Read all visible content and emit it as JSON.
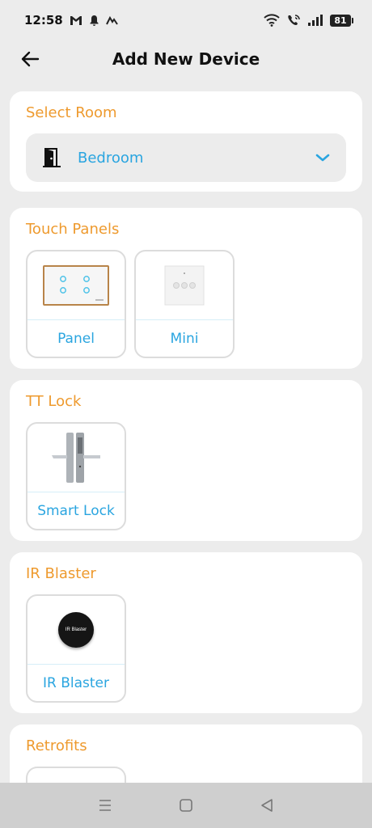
{
  "status_bar": {
    "time": "12:58",
    "battery": "81",
    "left_icons": [
      "gmail-icon",
      "notification-bell-icon",
      "app-icon"
    ],
    "right_icons": [
      "wifi-icon",
      "wifi-calling-icon",
      "signal-icon",
      "battery-icon"
    ]
  },
  "header": {
    "title": "Add New Device",
    "back_icon": "back-arrow-icon"
  },
  "select_room": {
    "title": "Select Room",
    "value": "Bedroom",
    "icon": "door-icon",
    "chevron_icon": "chevron-down-icon"
  },
  "sections": [
    {
      "title": "Touch Panels",
      "items": [
        {
          "label": "Panel",
          "image": "touch-panel-image"
        },
        {
          "label": "Mini",
          "image": "mini-panel-image"
        }
      ]
    },
    {
      "title": "TT Lock",
      "items": [
        {
          "label": "Smart Lock",
          "image": "smart-lock-image"
        }
      ]
    },
    {
      "title": "IR Blaster",
      "items": [
        {
          "label": "IR Blaster",
          "image": "ir-blaster-image",
          "image_text": "IR Blaster"
        }
      ]
    },
    {
      "title": "Retrofits",
      "items": []
    }
  ],
  "colors": {
    "accent_orange": "#ee9a2e",
    "accent_blue": "#2aa5e0",
    "background": "#ececec",
    "card": "#ffffff"
  },
  "nav_bar": {
    "icons": [
      "menu-icon",
      "home-square-icon",
      "back-triangle-icon"
    ]
  }
}
